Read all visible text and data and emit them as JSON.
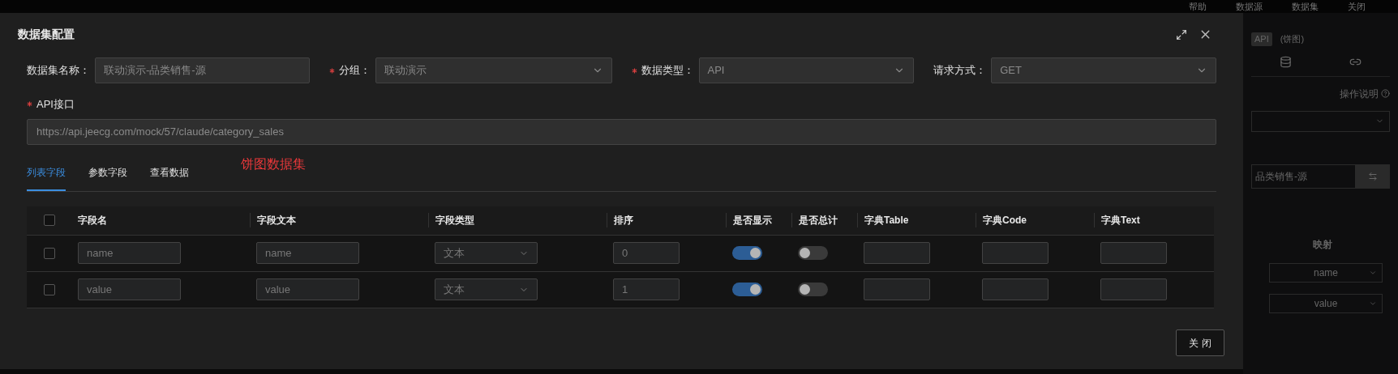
{
  "top_bar": {
    "items": [
      {
        "label": "帮助"
      },
      {
        "label": "数据源"
      },
      {
        "label": "数据集"
      },
      {
        "label": "关闭"
      }
    ]
  },
  "dialog": {
    "title": "数据集配置",
    "form": [
      {
        "kind": "input",
        "label": "数据集名称：",
        "required": false,
        "value": "联动演示-品类销售-源"
      },
      {
        "kind": "select",
        "label": "分组：",
        "required": true,
        "value": "联动演示"
      },
      {
        "kind": "select",
        "label": "数据类型：",
        "required": true,
        "value": "API"
      },
      {
        "kind": "select",
        "label": "请求方式：",
        "required": false,
        "value": "GET"
      }
    ],
    "api": {
      "label": "API接口",
      "required": true,
      "value": "https://api.jeecg.com/mock/57/claude/category_sales"
    },
    "tabs": [
      {
        "label": "列表字段",
        "selected": true
      },
      {
        "label": "参数字段",
        "selected": false
      },
      {
        "label": "查看数据",
        "selected": false
      }
    ],
    "note": "饼图数据集",
    "table": {
      "header_checked": false,
      "columns": [
        "字段名",
        "字段文本",
        "字段类型",
        "排序",
        "是否显示",
        "是否总计",
        "字典Table",
        "字典Code",
        "字典Text"
      ],
      "rows": [
        {
          "checked": false,
          "name": "name",
          "text": "name",
          "type": "文本",
          "order": "0",
          "show": true,
          "total": false
        },
        {
          "checked": false,
          "name": "value",
          "text": "value",
          "type": "文本",
          "order": "1",
          "show": true,
          "total": false
        }
      ]
    },
    "close_button": "关 闭"
  },
  "side_panel": {
    "tag": "API",
    "chart": "(饼图)",
    "help": "操作说明",
    "dataset": "品类销售-源",
    "mapping_header": "映射",
    "mappings": [
      "name",
      "value"
    ]
  }
}
